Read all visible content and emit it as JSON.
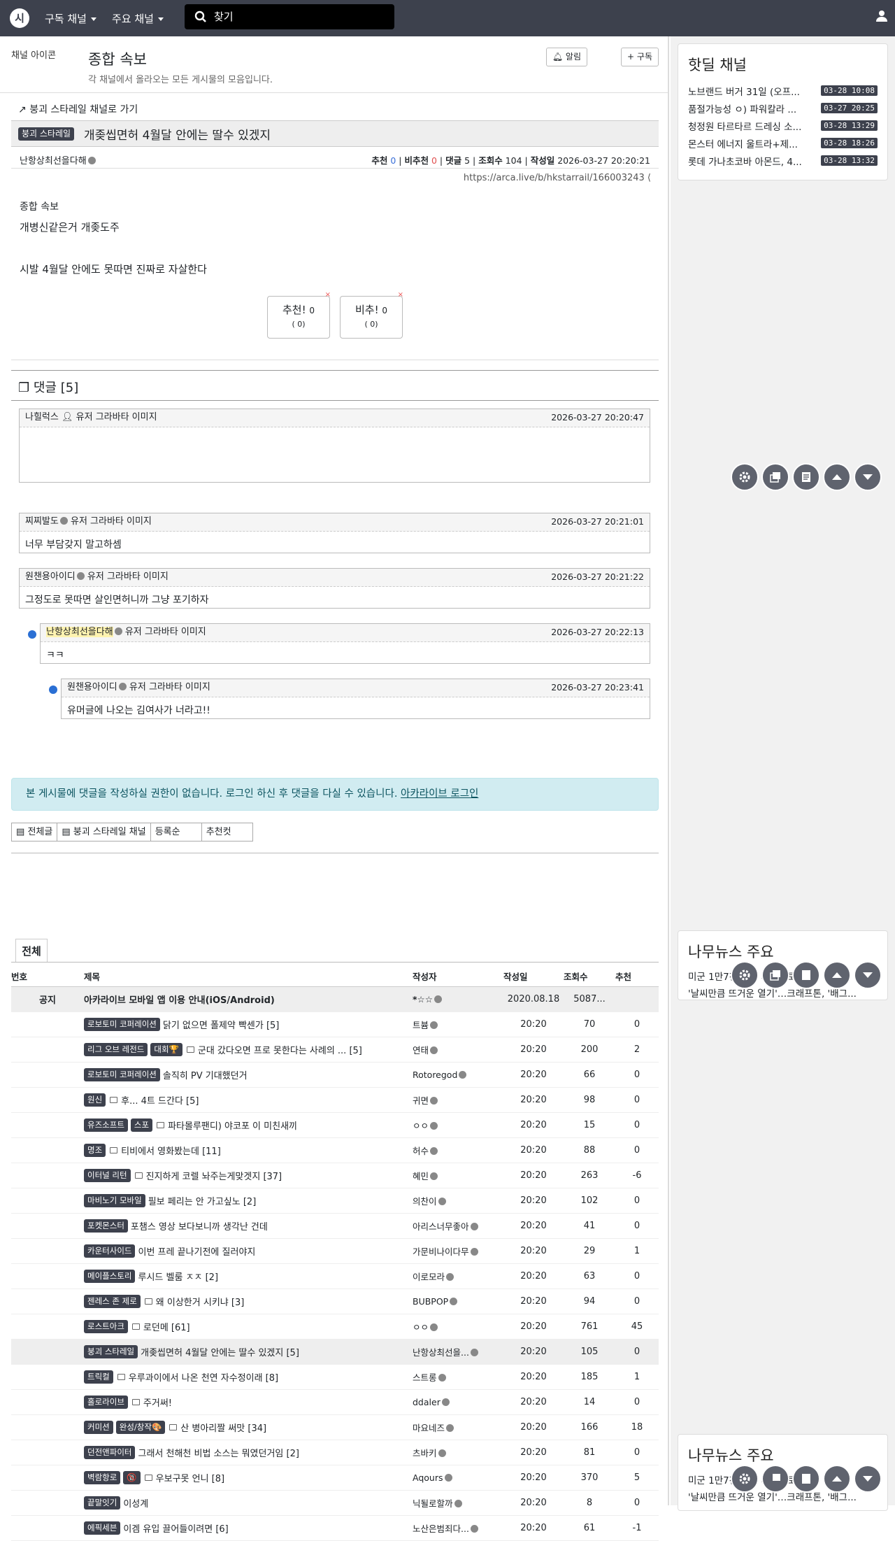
{
  "nav": {
    "menu1": "구독 채널",
    "menu2": "주요 채널",
    "search_placeholder": "찾기"
  },
  "channel": {
    "img_alt": "채널 아이콘",
    "name": "종합 속보",
    "desc": "각 채널에서 올라오는 모든 게시물의 모음입니다.",
    "alarm": "알림",
    "subscribe": "구독"
  },
  "post": {
    "back": "붕괴 스타레일 채널로 가기",
    "badge": "붕괴 스타레일",
    "title": "개좆씹면허 4월달 안에는 딸수 있겠지",
    "author": "난항상최선을다해",
    "rec_label": "추천",
    "rec": "0",
    "nrec_label": "비추천",
    "nrec": "0",
    "cmt_label": "댓글",
    "cmt": "5",
    "view_label": "조회수",
    "views": "104",
    "date_label": "작성일",
    "date": "2026-03-27 20:20:21",
    "url": "https://arca.live/b/hkstarrail/166003243",
    "img_alt": "종합 속보",
    "line1": "개병신같은거 개좆도주",
    "line2": "시발 4월달 안에도 못따면 진짜로 자살한다",
    "up_label": "추천!",
    "up_count": "0",
    "up_sub": "( 0)",
    "down_label": "비추!",
    "down_count": "0",
    "down_sub": "( 0)"
  },
  "comments": {
    "header": "댓글 [5]",
    "avatar_alt": "유저 그라바타 이미지",
    "items": [
      {
        "author": "나힐럭스",
        "time": "2026-03-27 20:20:47",
        "text": ""
      },
      {
        "author": "찌찌발도",
        "time": "2026-03-27 20:21:01",
        "text": "너무 부담갖지 말고하셈"
      },
      {
        "author": "원챈용아이디",
        "time": "2026-03-27 20:21:22",
        "text": "그정도로 못따면 살인면허니까 그냥 포기하자"
      },
      {
        "author": "난항상최선을다해",
        "time": "2026-03-27 20:22:13",
        "text": "ㅋㅋ"
      },
      {
        "author": "원챈용아이디",
        "time": "2026-03-27 20:23:41",
        "text": "유머글에 나오는 김여사가 너라고!!"
      }
    ]
  },
  "alert": {
    "text": "본 게시물에 댓글을 작성하실 권한이 없습니다. 로그인 하신 후 댓글을 다실 수 있습니다.",
    "link": "아카라이브 로그인"
  },
  "filters": [
    "전체글",
    "붕괴 스타레일 채널",
    "등록순",
    "추천컷"
  ],
  "list": {
    "tab": "전체",
    "headers": [
      "번호",
      "제목",
      "작성자",
      "작성일",
      "조회수",
      "추천"
    ],
    "notice": {
      "no": "공지",
      "title": "아카라이브 모바일 앱 이용 안내(iOS/Android)",
      "author": "*☆☆",
      "date": "2020.08.18",
      "views": "5087...",
      "rec": ""
    },
    "rows": [
      {
        "badges": [
          "로보토미 코퍼레이션"
        ],
        "icon": false,
        "title": "닭기 없으면 폴제약 빡센가 [5]",
        "author": "트븀",
        "date": "20:20",
        "views": "70",
        "rec": "0"
      },
      {
        "badges": [
          "리그 오브 레전드",
          "대회🏆"
        ],
        "icon": true,
        "title": "군대 갔다오면 프로 못한다는 사례의 ... [5]",
        "author": "연태",
        "date": "20:20",
        "views": "200",
        "rec": "2"
      },
      {
        "badges": [
          "로보토미 코퍼레이션"
        ],
        "icon": false,
        "title": "솔직히 PV 기대했던거",
        "author": "Rotoregod",
        "date": "20:20",
        "views": "66",
        "rec": "0"
      },
      {
        "badges": [
          "원신"
        ],
        "icon": true,
        "title": "후... 4트 드간다 [5]",
        "author": "귀면",
        "date": "20:20",
        "views": "98",
        "rec": "0"
      },
      {
        "badges": [
          "유즈소프트",
          "스포"
        ],
        "icon": true,
        "title": "파타몰루팬디) 야코포 이 미친새끼",
        "author": "ㅇㅇ",
        "date": "20:20",
        "views": "15",
        "rec": "0"
      },
      {
        "badges": [
          "명조"
        ],
        "icon": true,
        "title": "티비에서 영화봤는데 [11]",
        "author": "허수",
        "date": "20:20",
        "views": "88",
        "rec": "0"
      },
      {
        "badges": [
          "이터널 리턴"
        ],
        "icon": true,
        "title": "진지하게 코렐 놔주는게맞겟지 [37]",
        "author": "혜민",
        "date": "20:20",
        "views": "263",
        "rec": "-6"
      },
      {
        "badges": [
          "마비노기 모바일"
        ],
        "icon": false,
        "title": "필보 페리는 안 가고싶노 [2]",
        "author": "의찬이",
        "date": "20:20",
        "views": "102",
        "rec": "0"
      },
      {
        "badges": [
          "포켓몬스터"
        ],
        "icon": false,
        "title": "포챔스 영상 보다보니까 생각난 건데",
        "author": "아리스너무좋아",
        "date": "20:20",
        "views": "41",
        "rec": "0"
      },
      {
        "badges": [
          "카운터사이드"
        ],
        "icon": false,
        "title": "이번 프레 끝나기전에 질러야지",
        "author": "가문비나이다무",
        "date": "20:20",
        "views": "29",
        "rec": "1"
      },
      {
        "badges": [
          "메이플스토리"
        ],
        "icon": false,
        "title": "루시드 벨룸 ㅈㅈ [2]",
        "author": "이로모라",
        "date": "20:20",
        "views": "63",
        "rec": "0"
      },
      {
        "badges": [
          "젠레스 존 제로"
        ],
        "icon": true,
        "title": "왜 이상한거 시키냐 [3]",
        "author": "BUBPOP",
        "date": "20:20",
        "views": "94",
        "rec": "0"
      },
      {
        "badges": [
          "로스트아크"
        ],
        "icon": true,
        "title": "로던메 [61]",
        "author": "ㅇㅇ",
        "date": "20:20",
        "views": "761",
        "rec": "45"
      },
      {
        "badges": [
          "붕괴 스타레일"
        ],
        "icon": false,
        "title": "개좆씹면허 4월달 안에는 딸수 있겠지 [5]",
        "author": "난항상최선을...",
        "date": "20:20",
        "views": "105",
        "rec": "0",
        "cur": true
      },
      {
        "badges": [
          "트릭컬"
        ],
        "icon": true,
        "title": "우루과이에서 나온 천연 자수정이래 [8]",
        "author": "스트롱",
        "date": "20:20",
        "views": "185",
        "rec": "1"
      },
      {
        "badges": [
          "홀로라이브"
        ],
        "icon": true,
        "title": "주거써!",
        "author": "ddaler",
        "date": "20:20",
        "views": "14",
        "rec": "0"
      },
      {
        "badges": [
          "커미션",
          "완성/창작🎨"
        ],
        "icon": true,
        "title": "산 병아리짤 써맛 [34]",
        "author": "마요네즈",
        "date": "20:20",
        "views": "166",
        "rec": "18"
      },
      {
        "badges": [
          "던전앤파이터"
        ],
        "icon": false,
        "title": "그래서 천해천 비법 소스는 뭐였던거임 [2]",
        "author": "츠바키",
        "date": "20:20",
        "views": "81",
        "rec": "0"
      },
      {
        "badges": [
          "벽람항로",
          "🔞"
        ],
        "icon": true,
        "title": "우보구못 언니 [8]",
        "author": "Aqours",
        "date": "20:20",
        "views": "370",
        "rec": "5"
      },
      {
        "badges": [
          "끝말잇기"
        ],
        "icon": false,
        "title": "이성계",
        "author": "닉될로할까",
        "date": "20:20",
        "views": "8",
        "rec": "0"
      },
      {
        "badges": [
          "에픽세븐"
        ],
        "icon": false,
        "title": "이겜 유입 끌어들이려면 [6]",
        "author": "노산은범죄다...",
        "date": "20:20",
        "views": "61",
        "rec": "-1"
      }
    ]
  },
  "side": {
    "hot_title": "핫딜 채널",
    "hot": [
      {
        "t": "노브랜드 버거 31일 (오프...",
        "d": "03-28 10:08"
      },
      {
        "t": "품절가능성 ㅇ) 파워칼라 ...",
        "d": "03-27 20:25"
      },
      {
        "t": "청정원 타르타르 드레싱 소...",
        "d": "03-28 13:29"
      },
      {
        "t": "몬스터 에너지 울트라+제...",
        "d": "03-28 18:26"
      },
      {
        "t": "롯데 가나초코바 아몬드, 4...",
        "d": "03-28 13:32"
      }
    ],
    "news_title": "나무뉴스 주요",
    "news": [
      "미군 1만7천 추가 파병검토 ...",
      "'날씨만큼 뜨거운 열기'…크래프톤, '배그..."
    ]
  }
}
